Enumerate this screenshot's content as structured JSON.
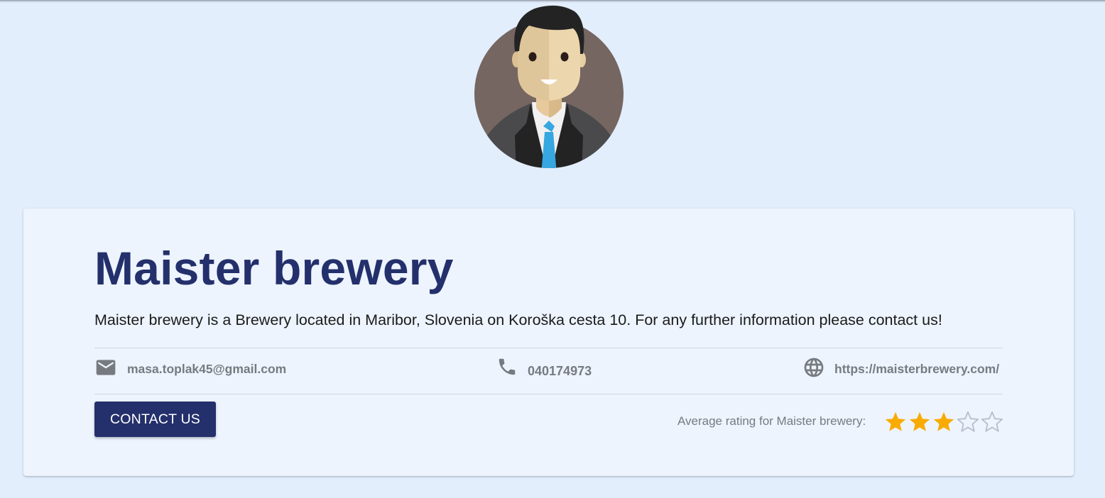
{
  "brewery": {
    "name": "Maister brewery",
    "description": "Maister brewery is a Brewery located in Maribor, Slovenia on Koroška cesta 10. For any further information please contact us!"
  },
  "contact": {
    "email": "masa.toplak45@gmail.com",
    "phone": "040174973",
    "website": "https://maisterbrewery.com/"
  },
  "actions": {
    "contact_label": "CONTACT US"
  },
  "rating": {
    "label": "Average rating for Maister brewery:",
    "value": 3,
    "max": 5
  },
  "icons": {
    "avatar": "businessman-avatar",
    "email": "mail-icon",
    "phone": "phone-icon",
    "website": "globe-icon",
    "star": "star-icon"
  },
  "colors": {
    "background": "#e3eefd",
    "card": "#edf4fe",
    "title": "#24306b",
    "button": "#24306b",
    "muted": "#777b80",
    "star_filled": "#f9ab02",
    "star_empty": "#b9bfca"
  }
}
